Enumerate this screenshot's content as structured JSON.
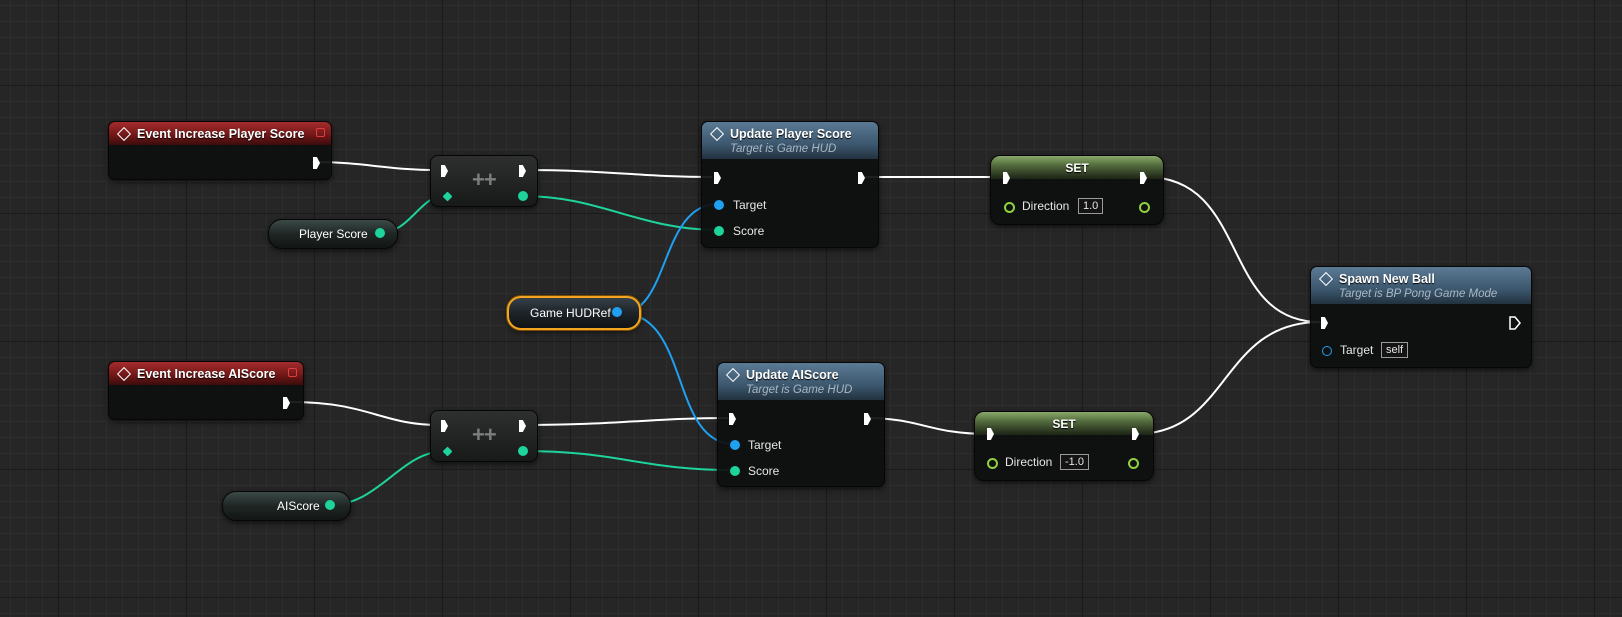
{
  "nodes": {
    "event_player": {
      "title": "Event Increase Player Score"
    },
    "event_ai": {
      "title": "Event Increase AIScore"
    },
    "var_player_score": {
      "label": "Player Score"
    },
    "var_ai_score": {
      "label": "AIScore"
    },
    "var_game_hud": {
      "label": "Game HUDRef"
    },
    "inc_symbol": "++",
    "update_player": {
      "title": "Update Player Score",
      "subtitle": "Target is Game HUD",
      "pin_target": "Target",
      "pin_score": "Score"
    },
    "update_ai": {
      "title": "Update AIScore",
      "subtitle": "Target is Game HUD",
      "pin_target": "Target",
      "pin_score": "Score"
    },
    "set_top": {
      "title": "SET",
      "pin_label": "Direction",
      "value": "1.0"
    },
    "set_bottom": {
      "title": "SET",
      "pin_label": "Direction",
      "value": "-1.0"
    },
    "spawn_ball": {
      "title": "Spawn New Ball",
      "subtitle": "Target is BP Pong Game Mode",
      "pin_target": "Target",
      "target_value": "self"
    }
  },
  "colors": {
    "event_header": "#a52c2c",
    "function_header": "#4a6880",
    "set_header": "#89a96a",
    "exec_wire": "#ffffff",
    "int_pin": "#1ed39c",
    "object_pin": "#1fa0f0",
    "float_pin": "#8fd23d",
    "selection": "#f3a520"
  }
}
